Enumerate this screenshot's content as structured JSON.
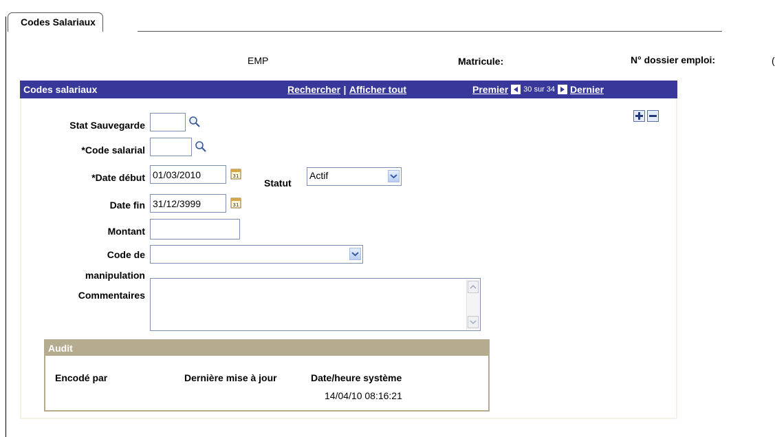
{
  "tab": {
    "label": "Codes Salariaux"
  },
  "header": {
    "emp": "EMP",
    "matricule_label": "Matricule:",
    "dossier_label": "N° dossier emploi:",
    "dossier_value_partial": "("
  },
  "grid": {
    "title": "Codes salariaux",
    "search_link": "Rechercher",
    "separator": "|",
    "show_all_link": "Afficher tout",
    "first_link": "Premier",
    "position": "30 sur 34",
    "last_link": "Dernier"
  },
  "form": {
    "stat_label": "Stat Sauvegarde",
    "stat_value": "",
    "code_label": "*Code salarial",
    "code_value": "",
    "date_debut_label": "*Date début",
    "date_debut_value": "01/03/2010",
    "statut_label": "Statut",
    "statut_value": "Actif",
    "date_fin_label": "Date fin",
    "date_fin_value": "31/12/3999",
    "montant_label": "Montant",
    "montant_value": "",
    "manip_label_1": "Code de",
    "manip_label_2": "manipulation",
    "manip_value": "",
    "comments_label": "Commentaires",
    "comments_value": ""
  },
  "audit": {
    "title": "Audit",
    "encoded_by_label": "Encodé par",
    "last_update_label": "Dernière mise à jour",
    "system_date_label": "Date/heure système",
    "system_date_value": "14/04/10 08:16:21"
  },
  "colors": {
    "grid_header": "#38389a",
    "panel_bg": "#f7f1e3",
    "audit_border": "#b5ab8e"
  }
}
